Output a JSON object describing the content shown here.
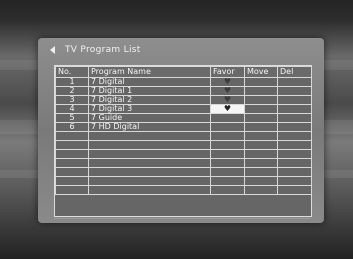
{
  "header": {
    "title": "TV Program List"
  },
  "columns": {
    "no": "No.",
    "name": "Program Name",
    "favor": "Favor",
    "move": "Move",
    "del": "Del"
  },
  "rows": [
    {
      "no": "1",
      "name": "7 Digital",
      "favor": "♥",
      "move": "",
      "del": ""
    },
    {
      "no": "2",
      "name": "7 Digital 1",
      "favor": "♥",
      "move": "",
      "del": ""
    },
    {
      "no": "3",
      "name": "7 Digital 2",
      "favor": "♥",
      "move": "",
      "del": ""
    },
    {
      "no": "4",
      "name": "7 Digital 3",
      "favor": "♥",
      "move": "",
      "del": ""
    },
    {
      "no": "5",
      "name": "7 Guide",
      "favor": "",
      "move": "",
      "del": ""
    },
    {
      "no": "6",
      "name": "7 HD Digital",
      "favor": "",
      "move": "",
      "del": ""
    }
  ],
  "empty_row_count": 7,
  "selected_row": 3
}
